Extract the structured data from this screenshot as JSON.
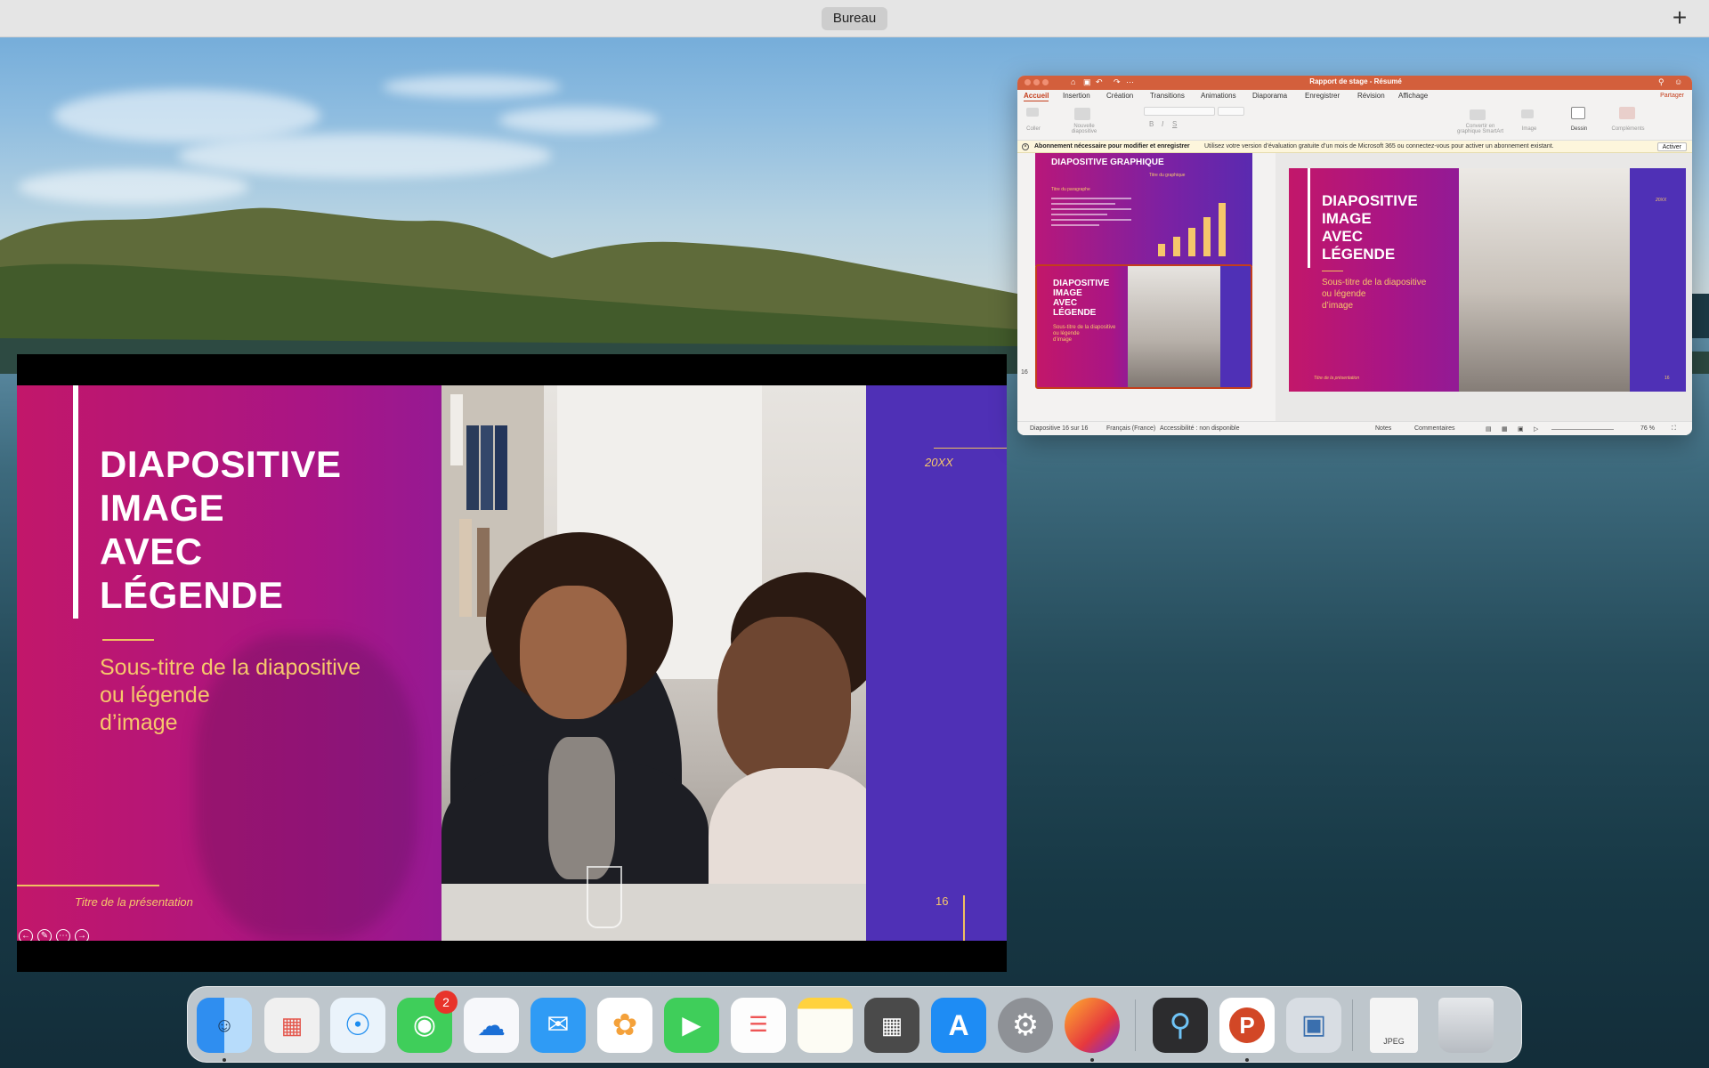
{
  "spaces_bar": {
    "label": "Bureau",
    "add_symbol": "+"
  },
  "slideshow": {
    "title": "DIAPOSITIVE\nIMAGE\nAVEC\nLÉGENDE",
    "subtitle": "Sous-titre de la diapositive\nou légende\nd’image",
    "footer": "Titre de la présentation",
    "year": "20XX",
    "slide_number": "16",
    "controls": [
      "previous-icon",
      "pen-icon",
      "more-icon",
      "next-icon"
    ]
  },
  "powerpoint": {
    "window_title": "Rapport de stage - Résumé",
    "tabs": [
      "Accueil",
      "Insertion",
      "Création",
      "Transitions",
      "Animations",
      "Diaporama",
      "Enregistrer",
      "Révision",
      "Affichage"
    ],
    "active_tab": "Accueil",
    "share_label": "Partager",
    "ribbon": {
      "paste": "Coller",
      "new_slide": "Nouvelle\ndiapositive",
      "smartart": "Convertir en\ngraphique SmartArt",
      "image": "Image",
      "draw": "Dessin",
      "addins": "Compléments"
    },
    "banner": {
      "bold": "Abonnement nécessaire pour modifier et enregistrer",
      "text": "Utilisez votre version d’évaluation gratuite d’un mois de Microsoft 365 ou connectez-vous pour activer un abonnement existant.",
      "button": "Activer"
    },
    "thumbnails": {
      "slide15": {
        "title": "DIAPOSITIVE GRAPHIQUE",
        "paragraph_title": "Titre du paragraphe",
        "chart_title": "Titre du graphique"
      },
      "slide16": {
        "number": "16",
        "title": "DIAPOSITIVE\nIMAGE\nAVEC\nLÉGENDE",
        "subtitle": "Sous-titre de la diapositive\nou légende\nd’image"
      }
    },
    "main_slide": {
      "title": "DIAPOSITIVE\nIMAGE\nAVEC\nLÉGENDE",
      "subtitle": "Sous-titre de la diapositive\nou légende\nd’image",
      "footer": "Titre de la présentation",
      "year": "20XX",
      "number": "16"
    },
    "status": {
      "slide_info": "Diapositive 16 sur 16",
      "language": "Français (France)",
      "accessibility": "Accessibilité : non disponible",
      "notes": "Notes",
      "comments": "Commentaires",
      "zoom": "76 %"
    }
  },
  "dock": {
    "items": [
      "finder",
      "launchpad",
      "safari",
      "messages",
      "onedrive",
      "mail",
      "photos",
      "facetime",
      "reminders",
      "notes",
      "calculator",
      "app-store",
      "system-settings",
      "firefox",
      "quicktime",
      "powerpoint",
      "preview",
      "jpeg-file",
      "trash"
    ],
    "messages_badge": "2",
    "jpeg_label": "JPEG"
  }
}
